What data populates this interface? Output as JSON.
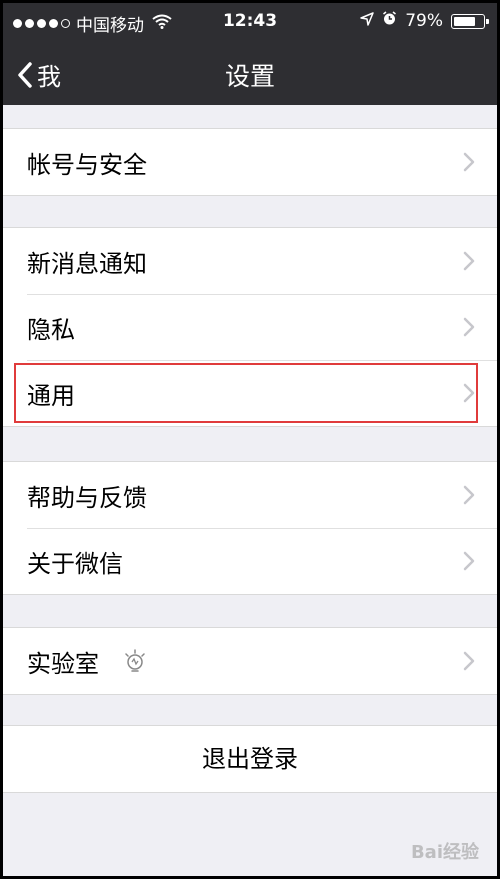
{
  "statusbar": {
    "carrier": "中国移动",
    "time": "12:43",
    "battery": "79%",
    "battery_level": 0.79
  },
  "navbar": {
    "back_label": "我",
    "title": "设置"
  },
  "groups": [
    {
      "items": [
        {
          "label": "帐号与安全"
        }
      ]
    },
    {
      "items": [
        {
          "label": "新消息通知"
        },
        {
          "label": "隐私"
        },
        {
          "label": "通用"
        }
      ]
    },
    {
      "items": [
        {
          "label": "帮助与反馈"
        },
        {
          "label": "关于微信"
        }
      ]
    },
    {
      "items": [
        {
          "label": "实验室"
        }
      ]
    }
  ],
  "logout_label": "退出登录",
  "watermark": "Bai经验",
  "highlight_color": "#e03b3b"
}
